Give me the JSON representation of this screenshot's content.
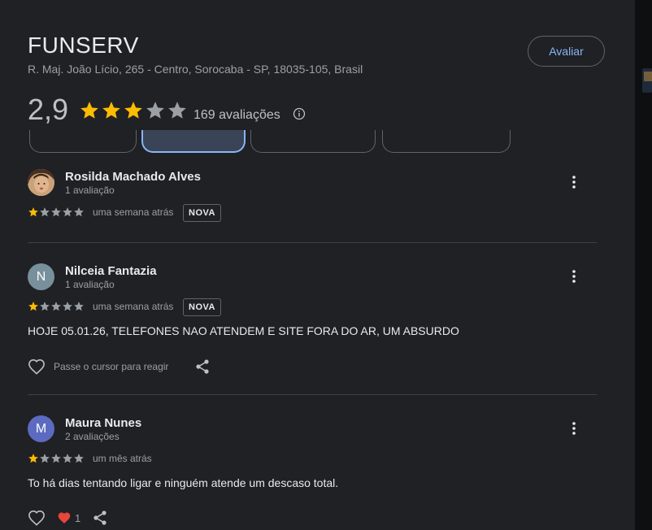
{
  "place": {
    "title": "FUNSERV",
    "address": "R. Maj. João Lício, 265 - Centro, Sorocaba - SP, 18035-105, Brasil",
    "rate_label": "Avaliar",
    "rating": "2,9",
    "rating_stars": 3,
    "reviews_count": "169 avaliações"
  },
  "reviews": [
    {
      "name": "Rosilda Machado Alves",
      "sub": "1 avaliação",
      "stars": 1,
      "when": "uma semana atrás",
      "badge": "NOVA"
    },
    {
      "name": "Nilceia Fantazia",
      "avatar_letter": "N",
      "sub": "1 avaliação",
      "stars": 1,
      "when": "uma semana atrás",
      "badge": "NOVA",
      "text": "HOJE 05.01.26, TELEFONES NAO ATENDEM E SITE FORA DO AR, UM ABSURDO",
      "react_label": "Passe o cursor para reagir"
    },
    {
      "name": "Maura Nunes",
      "avatar_letter": "M",
      "sub": "2 avaliações",
      "stars": 1,
      "when": "um mês atrás",
      "text": "To há dias tentando ligar e ninguém atende um descaso total.",
      "likes": "1"
    }
  ],
  "colors": {
    "star_filled": "#fbbc04",
    "star_empty": "#9aa0a6",
    "accent": "#8ab4f8",
    "avatar_n": "#78909c",
    "avatar_m": "#5c6bc0",
    "heart": "#e8453c"
  }
}
